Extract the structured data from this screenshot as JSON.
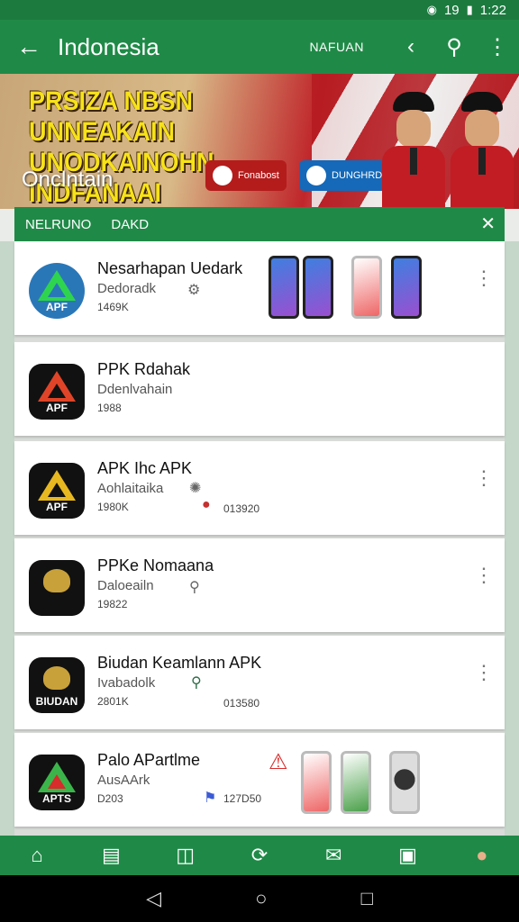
{
  "status_bar": {
    "wifi_icon": "wifi-icon",
    "signal": "19",
    "battery_icon": "battery-icon",
    "time": "1:22"
  },
  "app_bar": {
    "title": "Indonesia",
    "filter_label": "NAFUAN",
    "back_icon": "arrow-left-icon",
    "icons": [
      "chevron-left-icon",
      "search-icon",
      "more-vert-icon"
    ]
  },
  "hero": {
    "headline_line1": "PRSIZA NBSN UNNEAKAIN",
    "headline_line2": "UNODKAINOHN INDFANAAI",
    "subtitle": "Onclntain",
    "chip_red": "Fonabost",
    "chip_blue": "DUNGHRD IDOMSKAN"
  },
  "sheet": {
    "tab1": "NELRUNO",
    "tab2": "DAKD"
  },
  "apps": [
    {
      "name": "Nesarhapan Uedark",
      "dev": "Dedoradk",
      "size": "1469K",
      "icon_label": "APF"
    },
    {
      "name": "PPK Rdahak",
      "dev": "Ddenlvahain",
      "size": "1988",
      "icon_label": "APF"
    },
    {
      "name": "APK Ihc APK",
      "dev": "Aohlaitaika",
      "size": "1980K",
      "icon_label": "APF",
      "count": "013920"
    },
    {
      "name": "PPKe Nomaana",
      "dev": "Daloeailn",
      "size": "19822",
      "icon_label": ""
    },
    {
      "name": "Biudan Keamlann APK",
      "dev": "Ivabadolk",
      "size": "2801K",
      "icon_label": "BIUDAN",
      "count": "013580"
    },
    {
      "name": "Palo APartlme",
      "dev": "AusAArk",
      "size": "D203",
      "icon_label": "APTS",
      "count": "127D50"
    }
  ],
  "bottom_nav": [
    "home-icon",
    "chat-icon",
    "store-icon",
    "refresh-icon",
    "inbox-icon",
    "bookmark-icon",
    "person-icon"
  ],
  "system_nav": [
    "back-triangle-icon",
    "home-circle-icon",
    "recents-square-icon"
  ],
  "colors": {
    "primary": "#1f8a47",
    "status": "#1c7a3f",
    "headline": "#f7e21a"
  }
}
